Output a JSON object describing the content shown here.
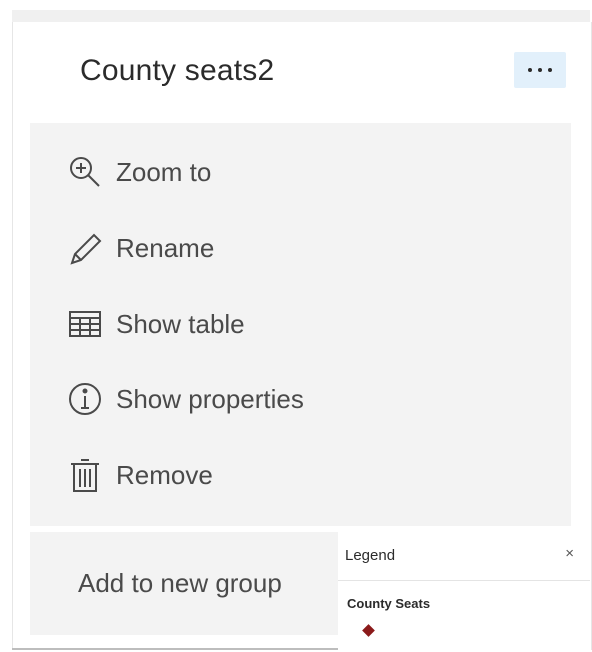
{
  "layer": {
    "title": "County seats2"
  },
  "menu": {
    "items": [
      {
        "label": "Zoom to",
        "icon": "zoom-in-icon"
      },
      {
        "label": "Rename",
        "icon": "pencil-icon"
      },
      {
        "label": "Show table",
        "icon": "table-icon"
      },
      {
        "label": "Show properties",
        "icon": "info-icon"
      },
      {
        "label": "Remove",
        "icon": "trash-icon"
      }
    ],
    "add_group_label": "Add to new group"
  },
  "legend": {
    "title": "Legend",
    "close": "×",
    "layer_name": "County Seats",
    "symbol_color": "#8b1a1a"
  },
  "colors": {
    "menu_bg": "#f3f3f3",
    "more_button_bg": "#e2f0fb"
  }
}
